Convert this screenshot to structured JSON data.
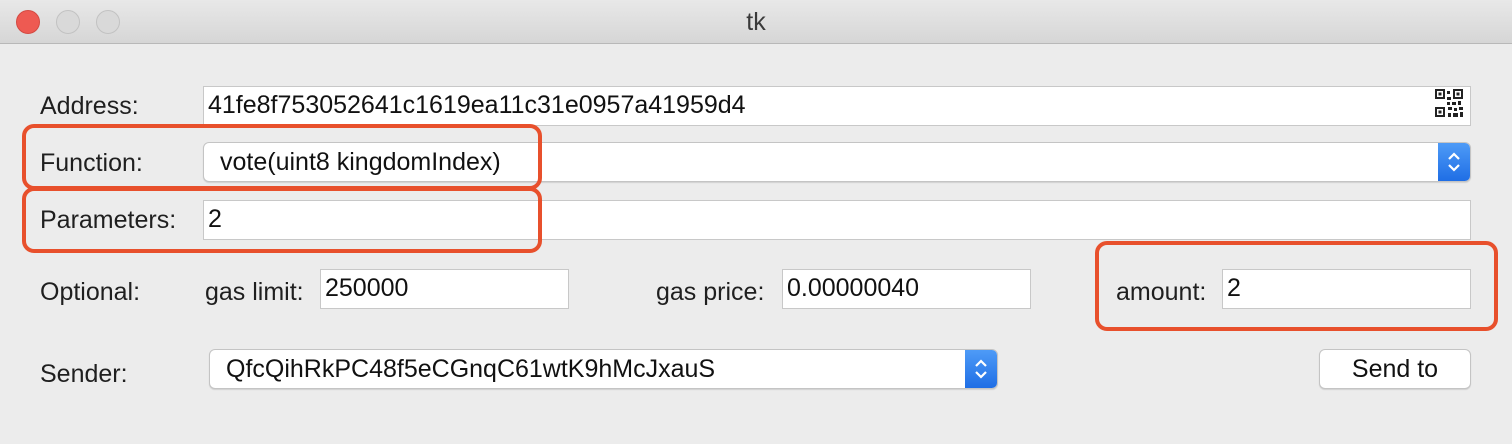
{
  "window": {
    "title": "tk"
  },
  "form": {
    "address_label": "Address:",
    "address_value": "41fe8f753052641c1619ea11c31e0957a41959d4",
    "function_label": "Function:",
    "function_value": "vote(uint8 kingdomIndex)",
    "parameters_label": "Parameters:",
    "parameters_value": "2",
    "optional_label": "Optional:",
    "gas_limit_label": "gas limit:",
    "gas_limit_value": "250000",
    "gas_price_label": "gas price:",
    "gas_price_value": "0.00000040",
    "amount_label": "amount:",
    "amount_value": "2",
    "sender_label": "Sender:",
    "sender_value": "QfcQihRkPC48f5eCGnqC61wtK9hMcJxauS",
    "send_button": "Send to"
  },
  "colors": {
    "highlight": "#e8502c",
    "accent": "#2f7ff0",
    "close_button": "#ee5a52"
  },
  "icons": {
    "qr": "qr-code-icon",
    "combo_arrows": "chevron-up-down-icon"
  }
}
